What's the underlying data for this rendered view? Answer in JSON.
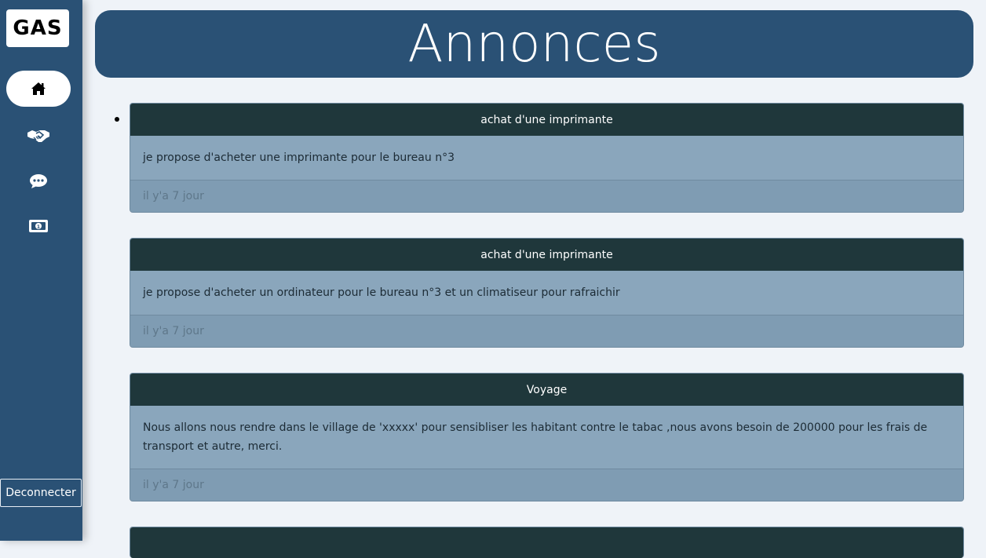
{
  "app": {
    "logo_text": "GAS"
  },
  "sidebar": {
    "items": [
      {
        "name": "home",
        "icon": "home-icon",
        "active": true
      },
      {
        "name": "deals",
        "icon": "handshake-icon",
        "active": false
      },
      {
        "name": "messages",
        "icon": "chat-icon",
        "active": false
      },
      {
        "name": "money",
        "icon": "money-bill-icon",
        "active": false
      }
    ],
    "logout_label": "Deconnecter"
  },
  "header": {
    "title": "Annonces"
  },
  "announcements": [
    {
      "title": "achat d'une imprimante",
      "body": "je propose d'acheter une imprimante pour le bureau n°3",
      "time": "il y'a 7 jour"
    },
    {
      "title": "achat d'une imprimante",
      "body": "je propose d'acheter un ordinateur pour le bureau n°3 et un climatiseur pour rafraichir",
      "time": "il y'a 7 jour"
    },
    {
      "title": "Voyage",
      "body": "Nous allons nous rendre dans le village de 'xxxxx' pour sensibliser les habitant contre le tabac ,nous avons besoin de 200000 pour les frais de transport et autre, merci.",
      "time": "il y'a 7 jour"
    }
  ],
  "colors": {
    "sidebar": "#2a5175",
    "card_header": "#1f373b",
    "card_body": "#8aa6bc",
    "page_bg": "#eff3f8"
  }
}
